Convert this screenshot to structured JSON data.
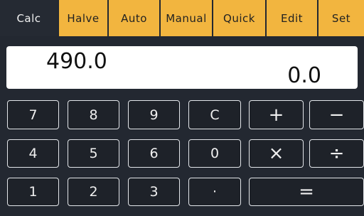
{
  "tabs": [
    {
      "label": "Calc",
      "active": true
    },
    {
      "label": "Halve",
      "active": false
    },
    {
      "label": "Auto",
      "active": false
    },
    {
      "label": "Manual",
      "active": false
    },
    {
      "label": "Quick",
      "active": false
    },
    {
      "label": "Edit",
      "active": false
    },
    {
      "label": "Set",
      "active": false
    }
  ],
  "display": {
    "expression": "490.0",
    "result": "0.0"
  },
  "keys": {
    "k7": "7",
    "k8": "8",
    "k9": "9",
    "clear": "C",
    "plus": "+",
    "minus": "−",
    "k4": "4",
    "k5": "5",
    "k6": "6",
    "k0": "0",
    "multiply": "×",
    "divide": "÷",
    "k1": "1",
    "k2": "2",
    "k3": "3",
    "dot": "·",
    "equals": "="
  },
  "colors": {
    "tab_bg": "#f2b53f",
    "active_tab_bg": "#252a33",
    "app_bg": "#232831",
    "key_border": "#e3e6ea",
    "display_bg": "#ffffff"
  }
}
